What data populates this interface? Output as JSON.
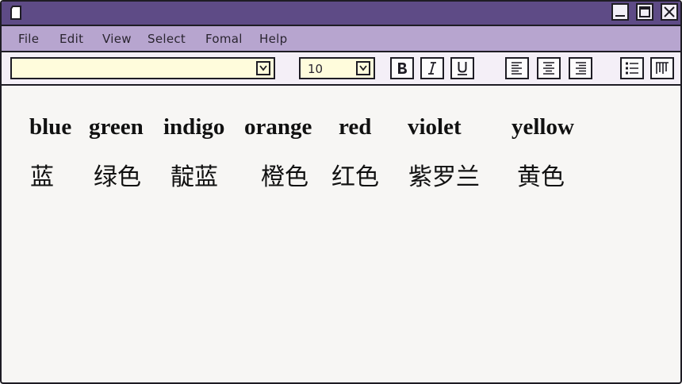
{
  "menu": [
    "File",
    "Edit",
    "View",
    "Select",
    "Fomal",
    "Help"
  ],
  "toolbar": {
    "font_value": "",
    "size_value": "10",
    "bold_icon": "bold-icon",
    "italic_icon": "italic-icon",
    "underline_icon": "underline-icon",
    "align_left_icon": "align-left-icon",
    "align_center_icon": "align-center-icon",
    "align_right_icon": "align-right-icon",
    "bulleted_list_icon": "bulleted-list-icon",
    "columns_icon": "columns-icon"
  },
  "content": {
    "english": [
      "blue",
      "green",
      "indigo",
      "orange",
      "red",
      "violet",
      "yellow"
    ],
    "chinese": [
      "蓝",
      "绿色",
      "靛蓝",
      "橙色",
      "红色",
      "紫罗兰",
      "黄色"
    ]
  },
  "colors": {
    "titlebar": "#5e4b86",
    "menubar": "#b7a5cf",
    "toolbar": "#f4eff7",
    "input_bg": "#fffcdc",
    "page_bg": "#f7f6f4"
  }
}
